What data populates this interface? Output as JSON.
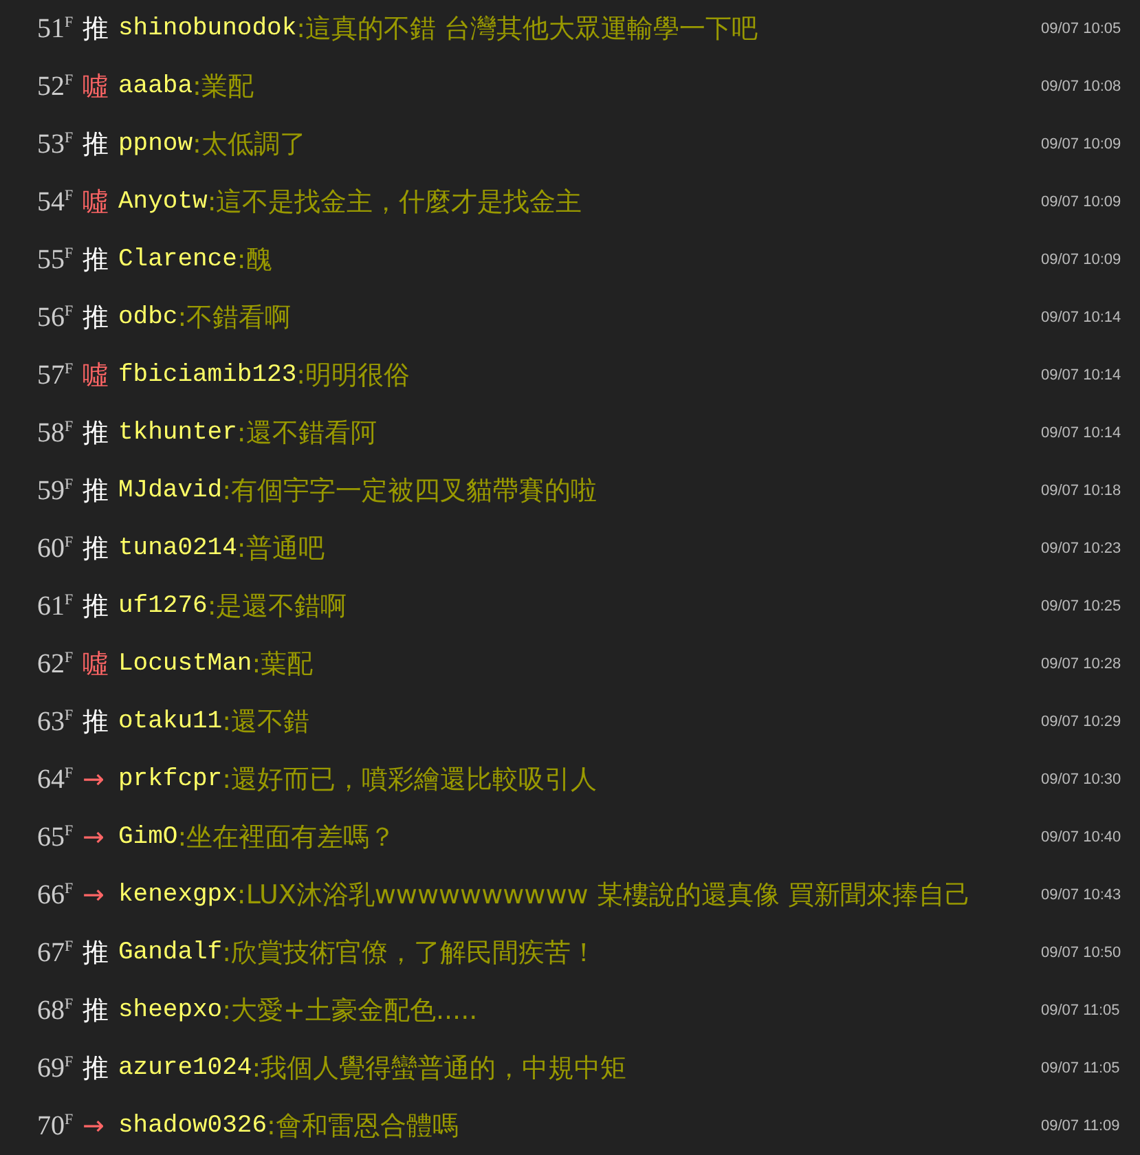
{
  "comments": [
    {
      "floor": "51$^{F}$",
      "kind": "push",
      "tag": "推",
      "user": "shinobunodok",
      "content": ":這真的不錯 台灣其他大眾運輸學一下吧",
      "time": "09/07 10:05"
    },
    {
      "floor": "52$^{F}$",
      "kind": "boo",
      "tag": "噓",
      "user": "aaaba",
      "content": ":業配",
      "time": "09/07 10:08"
    },
    {
      "floor": "53$^{F}$",
      "kind": "push",
      "tag": "推",
      "user": "ppnow",
      "content": ":太低調了",
      "time": "09/07 10:09"
    },
    {
      "floor": "54$^{F}$",
      "kind": "boo",
      "tag": "噓",
      "user": "Anyotw",
      "content": ":這不是找金主，什麼才是找金主",
      "time": "09/07 10:09"
    },
    {
      "floor": "55$^{F}$",
      "kind": "push",
      "tag": "推",
      "user": "Clarence",
      "content": ":醜",
      "time": "09/07 10:09"
    },
    {
      "floor": "56$^{F}$",
      "kind": "push",
      "tag": "推",
      "user": "odbc",
      "content": ":不錯看啊",
      "time": "09/07 10:14"
    },
    {
      "floor": "57$^{F}$",
      "kind": "boo",
      "tag": "噓",
      "user": "fbiciamib123",
      "content": ":明明很俗",
      "time": "09/07 10:14"
    },
    {
      "floor": "58$^{F}$",
      "kind": "push",
      "tag": "推",
      "user": "tkhunter",
      "content": ":還不錯看阿",
      "time": "09/07 10:14"
    },
    {
      "floor": "59$^{F}$",
      "kind": "push",
      "tag": "推",
      "user": "MJdavid",
      "content": ":有個宇字一定被四叉貓帶賽的啦",
      "time": "09/07 10:18"
    },
    {
      "floor": "60$^{F}$",
      "kind": "push",
      "tag": "推",
      "user": "tuna0214",
      "content": ":普通吧",
      "time": "09/07 10:23"
    },
    {
      "floor": "61$^{F}$",
      "kind": "push",
      "tag": "推",
      "user": "uf1276",
      "content": ":是還不錯啊",
      "time": "09/07 10:25"
    },
    {
      "floor": "62$^{F}$",
      "kind": "boo",
      "tag": "噓",
      "user": "LocustMan",
      "content": ":葉配",
      "time": "09/07 10:28"
    },
    {
      "floor": "63$^{F}$",
      "kind": "push",
      "tag": "推",
      "user": "otaku11",
      "content": ":還不錯",
      "time": "09/07 10:29"
    },
    {
      "floor": "64$^{F}$",
      "kind": "arrow",
      "tag": "→",
      "user": "prkfcpr",
      "content": ":還好而已，噴彩繪還比較吸引人",
      "time": "09/07 10:30"
    },
    {
      "floor": "65$^{F}$",
      "kind": "arrow",
      "tag": "→",
      "user": "GimO",
      "content": ":坐在裡面有差嗎？",
      "time": "09/07 10:40"
    },
    {
      "floor": "66$^{F}$",
      "kind": "arrow",
      "tag": "→",
      "user": "kenexgpx",
      "content": ":LUX沐浴乳wwwwwwwwww 某樓說的還真像 買新聞來捧自己",
      "time": "09/07 10:43"
    },
    {
      "floor": "67$^{F}$",
      "kind": "push",
      "tag": "推",
      "user": "Gandalf",
      "content": ":欣賞技術官僚，了解民間疾苦！",
      "time": "09/07 10:50"
    },
    {
      "floor": "68$^{F}$",
      "kind": "push",
      "tag": "推",
      "user": "sheepxo",
      "content": ":大愛+土豪金配色.....",
      "time": "09/07 11:05"
    },
    {
      "floor": "69$^{F}$",
      "kind": "push",
      "tag": "推",
      "user": "azure1024",
      "content": ":我個人覺得蠻普通的，中規中矩",
      "time": "09/07 11:05"
    },
    {
      "floor": "70$^{F}$",
      "kind": "arrow",
      "tag": "→",
      "user": "shadow0326",
      "content": ":會和雷恩合體嗎",
      "time": "09/07 11:09"
    }
  ]
}
